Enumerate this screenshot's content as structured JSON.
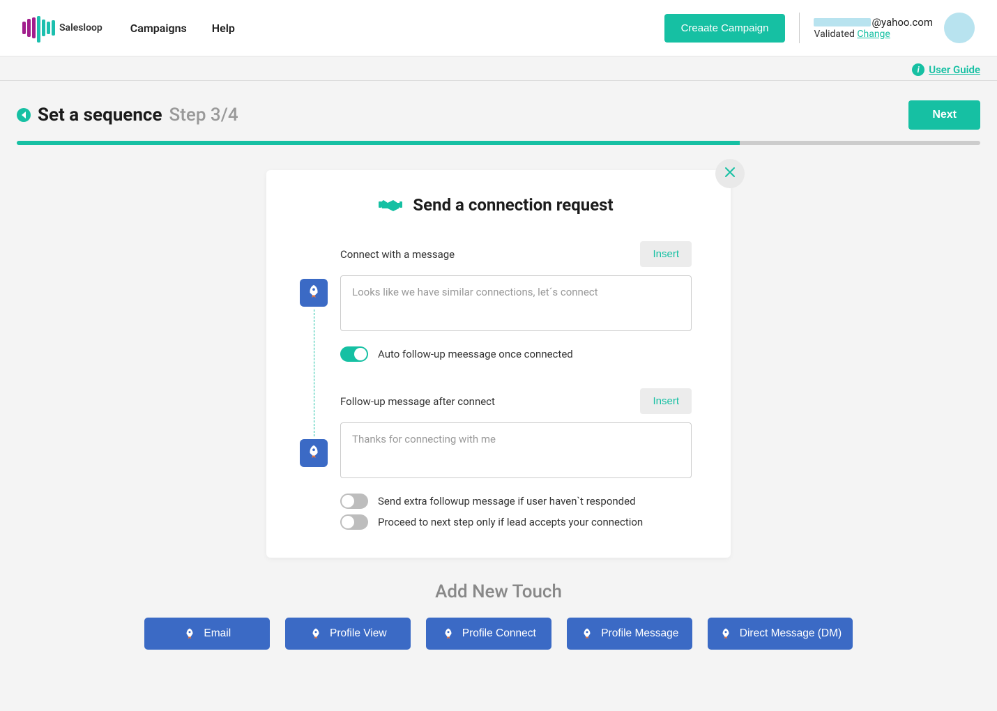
{
  "header": {
    "brand": "Salesloop",
    "nav": [
      "Campaigns",
      "Help"
    ],
    "create_btn": "Creaate Campaign",
    "email_suffix": "@yahoo.com",
    "validated_label": "Validated ",
    "change_link": "Change"
  },
  "subheader": {
    "guide": "User Guide"
  },
  "titlebar": {
    "title": "Set a sequence",
    "step": "Step 3/4",
    "next": "Next"
  },
  "progress_percent": 75,
  "card": {
    "title": "Send a connection request",
    "connect_label": "Connect with a message",
    "insert": "Insert",
    "connect_placeholder": "Looks like we have similar connections, let´s connect",
    "auto_followup": "Auto follow-up meessage once connected",
    "followup_label": "Follow-up message after connect",
    "followup_placeholder": "Thanks for connecting with me",
    "extra_followup": "Send extra followup message if user haven`t responded",
    "proceed_next": "Proceed to next step only if lead accepts your connection"
  },
  "add_touch": {
    "title": "Add New Touch",
    "buttons": [
      "Email",
      "Profile View",
      "Profile Connect",
      "Profile Message",
      "Direct Message (DM)"
    ]
  }
}
